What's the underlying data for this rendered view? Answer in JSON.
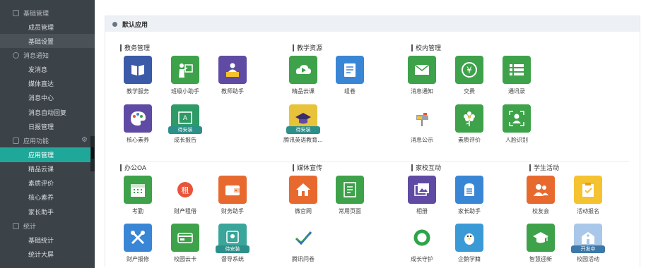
{
  "sidebar": {
    "sections": [
      {
        "title": "基础管理",
        "items": [
          "成员管理",
          "基础设置"
        ]
      },
      {
        "title": "消息通知",
        "items": [
          "发消息",
          "媒体直达",
          "消息中心",
          "消息自动回复",
          "日报管理"
        ]
      },
      {
        "title": "应用功能",
        "items": [
          "应用管理",
          "精品云课",
          "素质评价",
          "核心素养",
          "家长助手"
        ]
      },
      {
        "title": "统计",
        "items": [
          "基础统计",
          "统计大屏"
        ]
      }
    ]
  },
  "header": {
    "title": "默认应用"
  },
  "groups": [
    {
      "title": "教务管理"
    },
    {
      "title": "教学资源"
    },
    {
      "title": "校内管理"
    },
    {
      "title": "办公OA"
    },
    {
      "title": "媒体宣传"
    },
    {
      "title": "家校互动"
    },
    {
      "title": "学生活动"
    }
  ],
  "apps": [
    {
      "label": "教学服务",
      "color": "#3b5aa8",
      "icon": "book-icon"
    },
    {
      "label": "班级小助手",
      "color": "#3ea24a",
      "icon": "teacher-board-icon"
    },
    {
      "label": "教师助手",
      "color": "#5f4ba3",
      "icon": "teacher-desk-icon"
    },
    {
      "label": "精品云课",
      "color": "#3ea24a",
      "icon": "cloud-play-icon"
    },
    {
      "label": "组卷",
      "color": "#3a86d6",
      "icon": "test-paper-icon"
    },
    {
      "label": "消息通知",
      "color": "#3ea24a",
      "icon": "envelope-icon"
    },
    {
      "label": "交费",
      "color": "#3ea24a",
      "icon": "yen-icon"
    },
    {
      "label": "通讯录",
      "color": "#3ea24a",
      "icon": "list-icon"
    },
    {
      "label": "核心素养",
      "color": "#5f4ba3",
      "icon": "palette-icon"
    },
    {
      "label": "成长报告",
      "color": "#2e9a66",
      "icon": "report-icon",
      "badge": "待安装"
    },
    {
      "label": "腾讯英语教育...",
      "color": "#e8c33a",
      "icon": "graduation-cap-icon",
      "badge": "待安装"
    },
    {
      "label": "消息公示",
      "color": "#ffffff",
      "icon": "mailbox-icon"
    },
    {
      "label": "素质评价",
      "color": "#3ea24a",
      "icon": "flower-icon"
    },
    {
      "label": "人脸识别",
      "color": "#3ea24a",
      "icon": "face-id-icon"
    },
    {
      "label": "考勤",
      "color": "#3ea24a",
      "icon": "calendar-icon"
    },
    {
      "label": "财产租借",
      "color": "#e8543a",
      "icon": "rent-icon"
    },
    {
      "label": "财务助手",
      "color": "#e8692e",
      "icon": "wallet-icon"
    },
    {
      "label": "微官网",
      "color": "#e8692e",
      "icon": "home-icon"
    },
    {
      "label": "常用页面",
      "color": "#3ea24a",
      "icon": "page-icon"
    },
    {
      "label": "相册",
      "color": "#5f4ba3",
      "icon": "album-icon"
    },
    {
      "label": "家长助手",
      "color": "#3a86d6",
      "icon": "mailbox-front-icon"
    },
    {
      "label": "校友会",
      "color": "#e8692e",
      "icon": "people-icon"
    },
    {
      "label": "活动报名",
      "color": "#f5c230",
      "icon": "clipboard-check-icon"
    },
    {
      "label": "财产报修",
      "color": "#3a86d6",
      "icon": "tools-icon"
    },
    {
      "label": "校园云卡",
      "color": "#3ea24a",
      "icon": "card-icon"
    },
    {
      "label": "督导系统",
      "color": "#3aa59a",
      "icon": "supervise-icon",
      "badge": "待安装"
    },
    {
      "label": "腾讯问卷",
      "color": "#ffffff",
      "icon": "checkmark-icon"
    },
    {
      "label": "成长守护",
      "color": "#ffffff",
      "icon": "ring-icon"
    },
    {
      "label": "企鹅学籍",
      "color": "#3a9ad6",
      "icon": "penguin-icon"
    },
    {
      "label": "智慧迎新",
      "color": "#3ea24a",
      "icon": "mortarboard-icon"
    },
    {
      "label": "校园活动",
      "color": "#a9c7e8",
      "icon": "school-building-icon",
      "badge": "开发中"
    }
  ]
}
